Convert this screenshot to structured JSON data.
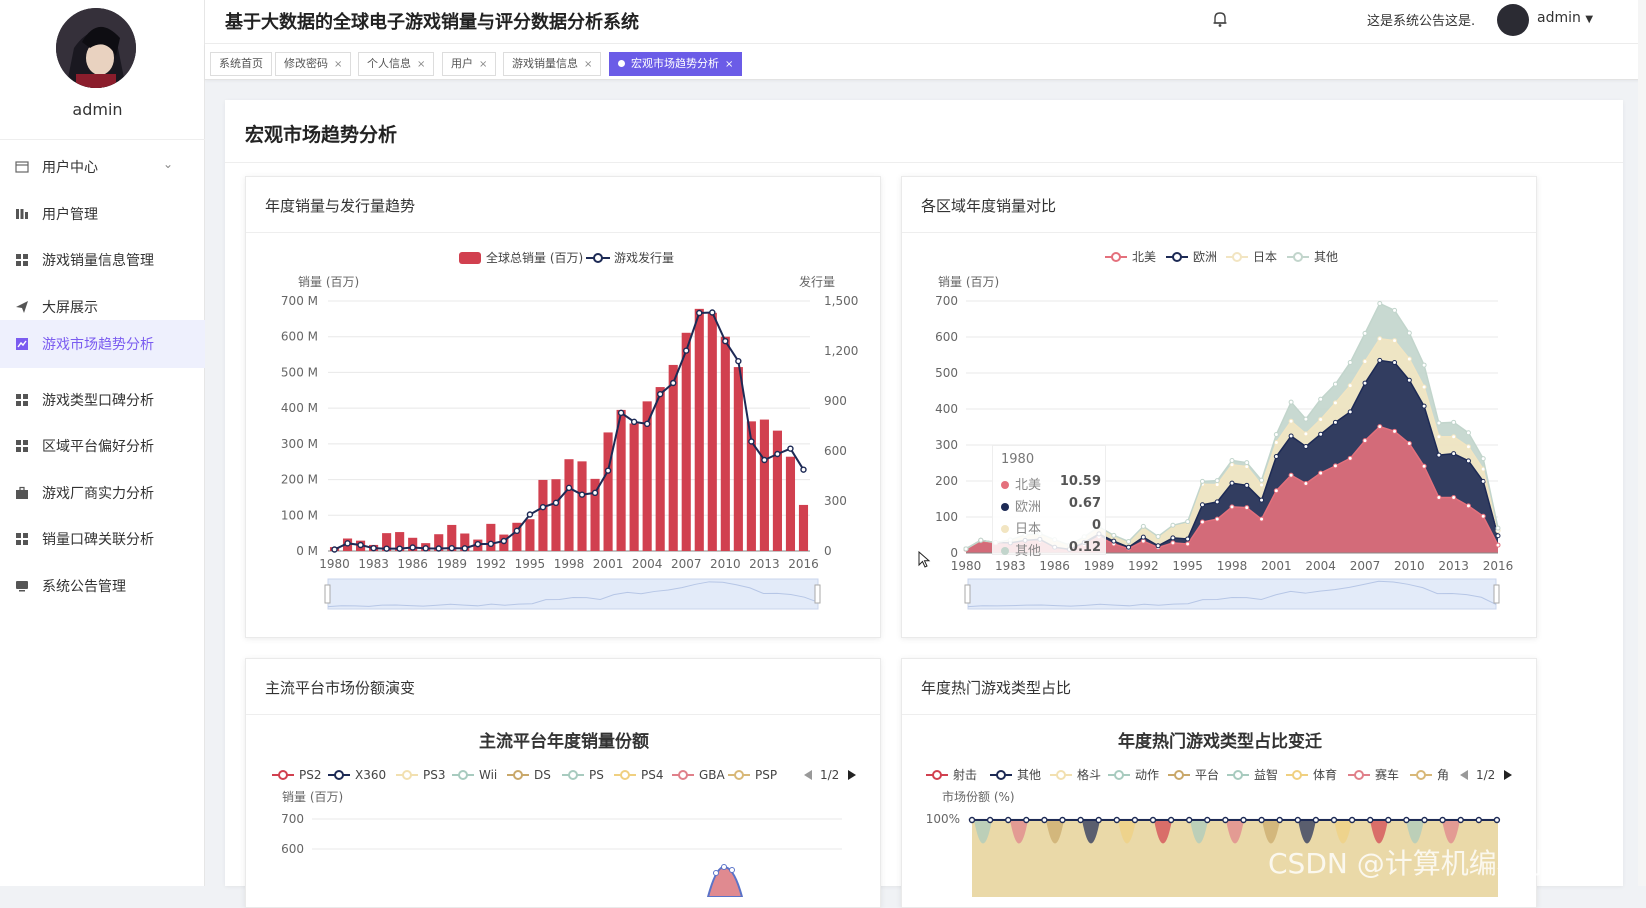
{
  "app": {
    "title": "基于大数据的全球电子游戏销量与评分数据分析系统",
    "notice": "这是系统公告这是.",
    "user": "admin"
  },
  "sidebar": {
    "username": "admin",
    "items": [
      {
        "label": "用户中心",
        "icon": "calendar-icon"
      },
      {
        "label": "用户管理",
        "icon": "bars-icon"
      },
      {
        "label": "游戏销量信息管理",
        "icon": "grid-icon"
      },
      {
        "label": "大屏展示",
        "icon": "send-icon"
      },
      {
        "label": "游戏市场趋势分析",
        "icon": "chart-icon"
      },
      {
        "label": "游戏类型口碑分析",
        "icon": "grid-icon"
      },
      {
        "label": "区域平台偏好分析",
        "icon": "grid-icon"
      },
      {
        "label": "游戏厂商实力分析",
        "icon": "briefcase-icon"
      },
      {
        "label": "销量口碑关联分析",
        "icon": "grid-icon"
      },
      {
        "label": "系统公告管理",
        "icon": "monitor-icon"
      }
    ]
  },
  "tabs": [
    {
      "label": "系统首页"
    },
    {
      "label": "修改密码"
    },
    {
      "label": "个人信息"
    },
    {
      "label": "用户"
    },
    {
      "label": "游戏销量信息"
    },
    {
      "label": "宏观市场趋势分析"
    }
  ],
  "page": {
    "title": "宏观市场趋势分析"
  },
  "cards": {
    "c1": {
      "title": "年度销量与发行量趋势"
    },
    "c2": {
      "title": "各区域年度销量对比"
    },
    "c3": {
      "title": "主流平台市场份额演变"
    },
    "c4": {
      "title": "年度热门游戏类型占比"
    }
  },
  "tooltip": {
    "year": "1980",
    "rows": [
      {
        "name": "北美",
        "value": "10.59",
        "color": "#e4707c"
      },
      {
        "name": "欧洲",
        "value": "0.67",
        "color": "#1d2a55"
      },
      {
        "name": "日本",
        "value": "0",
        "color": "#f2e5c2"
      },
      {
        "name": "其他",
        "value": "0.12",
        "color": "#c2d5cc"
      }
    ]
  },
  "watermark": "CSDN @计算机编程小央姐",
  "chart_data": [
    {
      "type": "bar+line",
      "legend": [
        "全球总销量 (百万)",
        "游戏发行量"
      ],
      "ylabel_left": "销量 (百万)",
      "ylabel_right": "发行量",
      "y_left_ticks": [
        "0 M",
        "100 M",
        "200 M",
        "300 M",
        "400 M",
        "500 M",
        "600 M",
        "700 M"
      ],
      "y_right_ticks": [
        "0",
        "300",
        "600",
        "900",
        "1,200",
        "1,500"
      ],
      "x_ticks": [
        "1980",
        "1983",
        "1986",
        "1989",
        "1992",
        "1995",
        "1998",
        "2001",
        "2004",
        "2007",
        "2010",
        "2013",
        "2016"
      ],
      "years": [
        1980,
        1981,
        1982,
        1983,
        1984,
        1985,
        1986,
        1987,
        1988,
        1989,
        1990,
        1991,
        1992,
        1993,
        1994,
        1995,
        1996,
        1997,
        1998,
        1999,
        2000,
        2001,
        2002,
        2003,
        2004,
        2005,
        2006,
        2007,
        2008,
        2009,
        2010,
        2011,
        2012,
        2013,
        2014,
        2015,
        2016
      ],
      "sales": [
        11,
        35,
        29,
        17,
        50,
        53,
        37,
        22,
        47,
        73,
        49,
        32,
        76,
        46,
        79,
        89,
        199,
        201,
        257,
        251,
        202,
        332,
        395,
        357,
        419,
        459,
        521,
        611,
        678,
        667,
        600,
        515,
        363,
        368,
        337,
        264,
        129
      ],
      "releases": [
        9,
        46,
        36,
        17,
        14,
        14,
        21,
        16,
        15,
        17,
        16,
        41,
        43,
        60,
        121,
        219,
        263,
        289,
        379,
        338,
        349,
        482,
        829,
        775,
        763,
        941,
        1008,
        1202,
        1428,
        1431,
        1259,
        1139,
        657,
        546,
        582,
        614,
        488
      ],
      "colors": {
        "bar": "#d1404f",
        "line": "#1d2a55"
      }
    },
    {
      "type": "area",
      "stacked": true,
      "legend": [
        "北美",
        "欧洲",
        "日本",
        "其他"
      ],
      "ylabel": "销量 (百万)",
      "y_ticks": [
        "0",
        "100",
        "200",
        "300",
        "400",
        "500",
        "600",
        "700"
      ],
      "x_ticks": [
        "1980",
        "1983",
        "1986",
        "1989",
        "1992",
        "1995",
        "1998",
        "2001",
        "2004",
        "2007",
        "2010",
        "2013",
        "2016"
      ],
      "years": [
        1980,
        1981,
        1982,
        1983,
        1984,
        1985,
        1986,
        1987,
        1988,
        1989,
        1990,
        1991,
        1992,
        1993,
        1994,
        1995,
        1996,
        1997,
        1998,
        1999,
        2000,
        2001,
        2002,
        2003,
        2004,
        2005,
        2006,
        2007,
        2008,
        2009,
        2010,
        2011,
        2012,
        2013,
        2014,
        2015,
        2016
      ],
      "series": [
        {
          "name": "北美",
          "color": "#e4707c",
          "values": [
            10.59,
            33,
            27,
            26,
            33,
            33,
            13,
            8,
            23,
            45,
            25,
            12,
            33,
            15,
            28,
            25,
            86,
            94,
            128,
            126,
            94,
            173,
            216,
            193,
            222,
            242,
            263,
            312,
            351,
            338,
            304,
            241,
            154,
            154,
            131,
            102,
            22
          ]
        },
        {
          "name": "欧洲",
          "color": "#1d2a55",
          "values": [
            0.67,
            2,
            2,
            2,
            2,
            5,
            3,
            2,
            6,
            8,
            8,
            4,
            11,
            5,
            14,
            14,
            48,
            48,
            66,
            62,
            53,
            95,
            109,
            103,
            108,
            121,
            129,
            160,
            184,
            191,
            176,
            167,
            118,
            122,
            125,
            97,
            26
          ]
        },
        {
          "name": "日本",
          "color": "#f2e5c2",
          "values": [
            0,
            0,
            0,
            8,
            15,
            15,
            19,
            11,
            15,
            18,
            15,
            15,
            29,
            25,
            33,
            45,
            57,
            48,
            51,
            52,
            42,
            39,
            41,
            35,
            41,
            54,
            73,
            60,
            60,
            61,
            59,
            53,
            51,
            47,
            39,
            34,
            14
          ]
        },
        {
          "name": "其他",
          "color": "#c2d5cc",
          "values": [
            0.12,
            0.3,
            0.3,
            0.4,
            0.7,
            0.9,
            2,
            1,
            1,
            2,
            1,
            1,
            1,
            1,
            2,
            3,
            8,
            11,
            12,
            11,
            13,
            22,
            53,
            41,
            56,
            52,
            64,
            78,
            98,
            84,
            72,
            61,
            38,
            40,
            39,
            29,
            7
          ]
        }
      ]
    },
    {
      "type": "line",
      "title": "主流平台年度销量份额",
      "legend": [
        "PS2",
        "X360",
        "PS3",
        "Wii",
        "DS",
        "PS",
        "PS4",
        "GBA",
        "PSP"
      ],
      "legend_page": "1/2",
      "ylabel": "销量 (百万)",
      "y_ticks": [
        "700",
        "600"
      ]
    },
    {
      "type": "area",
      "title": "年度热门游戏类型占比变迁",
      "legend": [
        "射击",
        "其他",
        "格斗",
        "动作",
        "平台",
        "益智",
        "体育",
        "赛车",
        "角"
      ],
      "legend_page": "1/2",
      "ylabel": "市场份额 (%)",
      "y_ticks": [
        "100%"
      ]
    }
  ]
}
